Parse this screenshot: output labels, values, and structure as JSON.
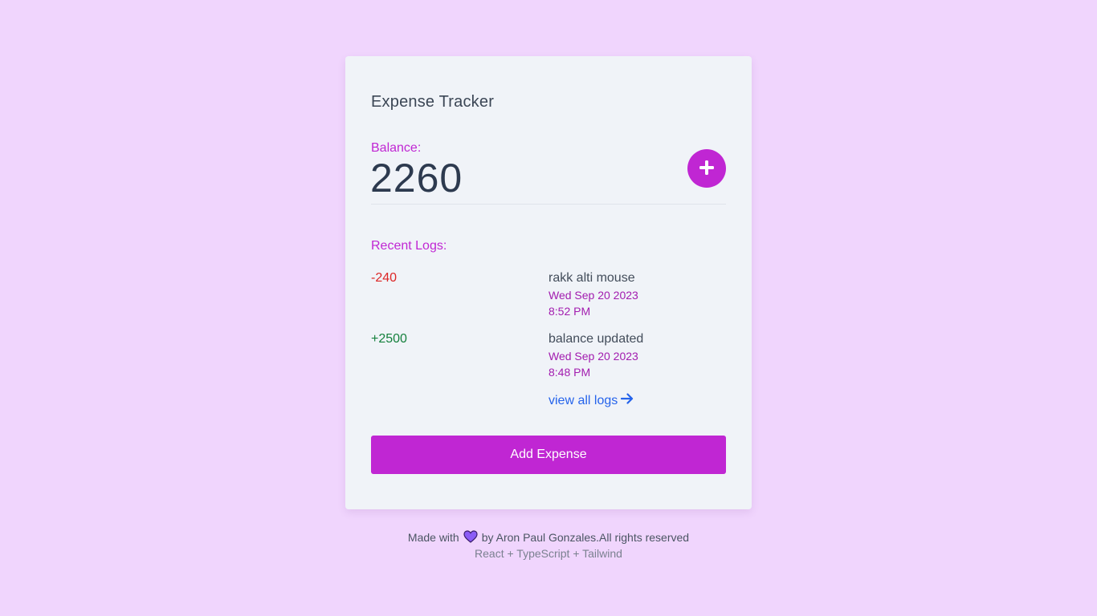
{
  "app": {
    "title": "Expense Tracker"
  },
  "balance": {
    "label": "Balance:",
    "value": "2260"
  },
  "logs": {
    "label": "Recent Logs:",
    "items": [
      {
        "amount": "-240",
        "amount_color": "#dc2626",
        "description": "rakk alti mouse",
        "date": "Wed Sep 20 2023",
        "time": "8:52 PM"
      },
      {
        "amount": "+2500",
        "amount_color": "#15803d",
        "description": "balance updated",
        "date": "Wed Sep 20 2023",
        "time": "8:48 PM"
      }
    ],
    "view_all_label": "view all logs"
  },
  "actions": {
    "add_expense_label": "Add Expense"
  },
  "footer": {
    "made_with": "Made with",
    "by_line": "by Aron Paul Gonzales.All rights reserved",
    "tech_stack": "React + TypeScript + Tailwind"
  },
  "icons": {
    "add": "plus-icon",
    "view_all": "arrow-right-icon",
    "made_with": "heart-icon"
  },
  "colors": {
    "background": "#f0d5fd",
    "card": "#f0f3f8",
    "accent": "#c026d3",
    "negative": "#dc2626",
    "positive": "#15803d",
    "link": "#2563eb"
  }
}
